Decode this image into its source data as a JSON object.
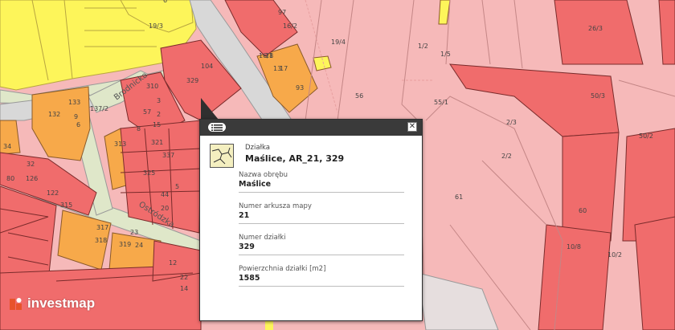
{
  "map": {
    "streets": [
      "Brodnicka",
      "Ostródzka"
    ],
    "plot_labels": [
      "19/3",
      "16/2",
      "19/4",
      "1/2",
      "1/5",
      "26/3",
      "6",
      "104",
      "329",
      "133",
      "137/2",
      "3",
      "2",
      "15",
      "6",
      "321",
      "337",
      "313",
      "9",
      "8",
      "325",
      "20",
      "34",
      "32",
      "132",
      "80",
      "16/1",
      "17",
      "97",
      "93",
      "56",
      "55/1",
      "2/3",
      "2/2",
      "50/3",
      "50/2",
      "61",
      "60",
      "10/8",
      "10/2",
      "126",
      "122",
      "315",
      "310",
      "317",
      "318",
      "319",
      "23",
      "24",
      "22",
      "14",
      "12",
      "13",
      "18",
      "5",
      "57",
      "44"
    ],
    "colors": {
      "residential_pink": "#f6b9b9",
      "parcel_red": "#f06c6c",
      "yellow_zone": "#fdf55a",
      "orange_zone": "#f7a94a",
      "road": "#dcdcdc",
      "green_road": "#dfe7c9"
    }
  },
  "popup": {
    "menu_icon": "list-icon",
    "close_icon": "close-icon",
    "header_small": "Działka",
    "header_title": "Maślice, AR_21, 329",
    "fields": [
      {
        "label": "Nazwa obrębu",
        "value": "Maślice"
      },
      {
        "label": "Numer arkusza mapy",
        "value": "21"
      },
      {
        "label": "Numer działki",
        "value": "329"
      },
      {
        "label": "Powierzchnia działki [m2]",
        "value": "1585"
      }
    ]
  },
  "logo": {
    "text": "investmap",
    "icon": "investmap-logo-icon",
    "accent": "#e8532b"
  }
}
